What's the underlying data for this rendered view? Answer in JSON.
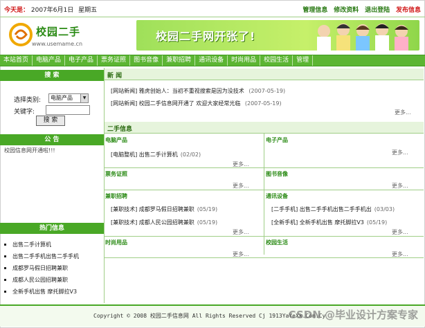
{
  "topbar": {
    "today_label": "今天是：",
    "date": "2007年6月1日",
    "weekday": "星期五",
    "links": [
      "管理信息",
      "修改资料",
      "退出登陆",
      "发布信息"
    ]
  },
  "logo": {
    "title": "校园二手",
    "url": "www.usemame.cn"
  },
  "banner": {
    "text": "校园二手网开张了!"
  },
  "nav": [
    "本站首页",
    "电脑产品",
    "电子产品",
    "票务证照",
    "图书音像",
    "兼职招聘",
    "通讯设备",
    "时尚用品",
    "校园生活",
    "管理"
  ],
  "search": {
    "header": "搜 索",
    "category_label": "选择类别:",
    "category_value": "电脑产品",
    "keyword_label": "关键字:",
    "button": "搜 索"
  },
  "notice": {
    "header": "公 告",
    "text": "校园信息网开通啦!!!"
  },
  "hot": {
    "header": "热门信息",
    "items": [
      "出售二手计算机",
      "出售二手手机出售二手手机",
      "成都罗马假日招聘兼职",
      "成都人民公园招聘兼职",
      "全新手机出售 摩托脚拉V3"
    ]
  },
  "news": {
    "header": "新 闻",
    "items": [
      {
        "text": "[网站新闻] 雅虎创始人：当初不重视搜索是因为没技术",
        "date": "(2007-05-19)"
      },
      {
        "text": "[网站新闻] 校园二手信息网开通了 欢迎大家经常光临",
        "date": "(2007-05-19)"
      }
    ],
    "more": "更多..."
  },
  "secondhand": {
    "header": "二手信息",
    "more": "更多...",
    "categories": [
      {
        "name": "电脑产品",
        "entries": [
          {
            "text": "[电脑整机] 出售二手计算机",
            "date": "(02/02)"
          }
        ]
      },
      {
        "name": "电子产品",
        "entries": []
      },
      {
        "name": "票务证照",
        "entries": []
      },
      {
        "name": "图书音像",
        "entries": []
      },
      {
        "name": "兼职招聘",
        "entries": [
          {
            "text": "[兼职技术] 成都罗马假日招聘兼职",
            "date": "(05/19)"
          },
          {
            "text": "[兼职技术] 成都人民公园招聘兼职",
            "date": "(05/19)"
          }
        ]
      },
      {
        "name": "通讯设备",
        "entries": [
          {
            "text": "[二手手机] 出售二手手机出售二手手机出",
            "date": "(03/03)"
          },
          {
            "text": "[全新手机] 全新手机出售 摩托脚拉V3",
            "date": "(05/19)"
          }
        ]
      },
      {
        "name": "时尚用品",
        "entries": []
      },
      {
        "name": "校园生活",
        "entries": []
      }
    ]
  },
  "footer": {
    "copyright": "Copyright © 2008 校园二手信息网 All Rights Reserved Cj 1913YaYeXk.Com.Cy",
    "watermark": "CSDN @毕业设计方案专家"
  },
  "colors": {
    "nav_bg": "#5cb533",
    "header_bg": "#49a826",
    "accent_red": "#d11a1a"
  }
}
